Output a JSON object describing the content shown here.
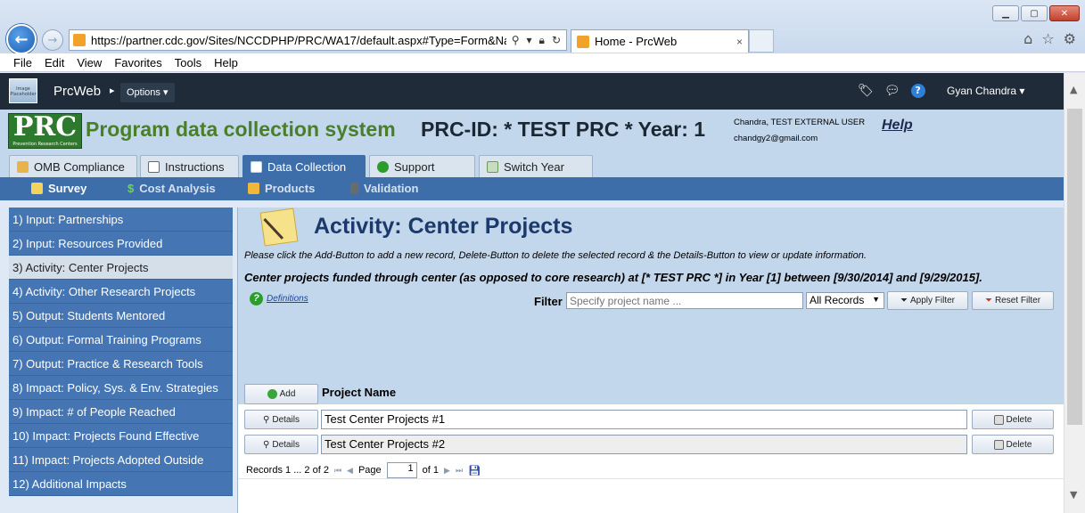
{
  "browser": {
    "url": "https://partner.cdc.gov/Sites/NCCDPHP/PRC/WA17/default.aspx#Type=Form&Name=",
    "tab_title": "Home - PrcWeb",
    "tab_close": "×",
    "menu": [
      "File",
      "Edit",
      "View",
      "Favorites",
      "Tools",
      "Help"
    ]
  },
  "app": {
    "logo_text": "Image Placeholder",
    "name": "PrcWeb",
    "options_label": "Options",
    "user_name": "Gyan Chandra"
  },
  "banner": {
    "logo_text": "PRC",
    "logo_subtext": "Prevention Research Centers",
    "system_name": "Program data collection system",
    "prc_id": "PRC-ID: * TEST PRC *  Year: 1",
    "user_line1": "Chandra, TEST EXTERNAL USER",
    "user_line2": "chandgy2@gmail.com",
    "help": "Help"
  },
  "main_tabs": [
    "OMB Compliance",
    "Instructions",
    "Data Collection",
    "Support",
    "Switch Year"
  ],
  "sub_tabs": [
    "Survey",
    "Cost Analysis",
    "Products",
    "Validation"
  ],
  "sidebar": [
    "1) Input: Partnerships",
    "2) Input: Resources Provided",
    "3) Activity: Center Projects",
    "4) Activity: Other Research Projects",
    "5) Output: Students Mentored",
    "6) Output: Formal Training Programs",
    "7) Output: Practice & Research Tools",
    "8) Impact: Policy, Sys. & Env. Strategies",
    "9) Impact: # of People Reached",
    "10) Impact: Projects Found Effective",
    "11) Impact: Projects Adopted Outside",
    "12) Additional Impacts"
  ],
  "form": {
    "title": "Activity: Center Projects",
    "instructions": "Please click the Add-Button to add a new record, Delete-Button to delete the selected record & the Details-Button to view or update information.",
    "description": "Center projects funded through center (as opposed to core research) at [* TEST PRC *] in Year [1] between [9/30/2014] and [9/29/2015].",
    "definitions": "Definitions",
    "filter_label": "Filter",
    "filter_placeholder": "Specify project name ...",
    "filter_select": "All Records",
    "apply_filter": "Apply Filter",
    "reset_filter": "Reset Filter",
    "add_label": "Add",
    "column_header": "Project Name",
    "details_label": "Details",
    "delete_label": "Delete",
    "rows": [
      "Test Center Projects #1",
      "Test Center Projects #2"
    ],
    "pager": {
      "records": "Records 1 ... 2 of 2",
      "page_label": "Page",
      "page_value": "1",
      "of_label": "of 1"
    }
  }
}
